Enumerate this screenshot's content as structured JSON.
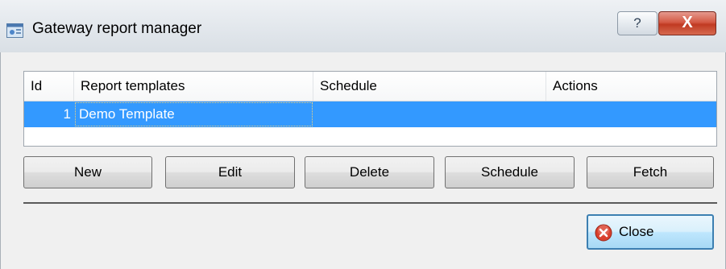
{
  "window": {
    "title": "Gateway report manager",
    "help_label": "?",
    "close_label": "X"
  },
  "grid": {
    "columns": [
      "Id",
      "Report templates",
      "Schedule",
      "Actions"
    ],
    "rows": [
      {
        "id": "1",
        "template": "Demo Template",
        "schedule": "",
        "actions": ""
      }
    ],
    "selection_color": "#3399ff"
  },
  "buttons": {
    "new": "New",
    "edit": "Edit",
    "delete": "Delete",
    "schedule": "Schedule",
    "fetch": "Fetch"
  },
  "footer": {
    "close_label": "Close",
    "close_icon": "close-circle-icon"
  }
}
